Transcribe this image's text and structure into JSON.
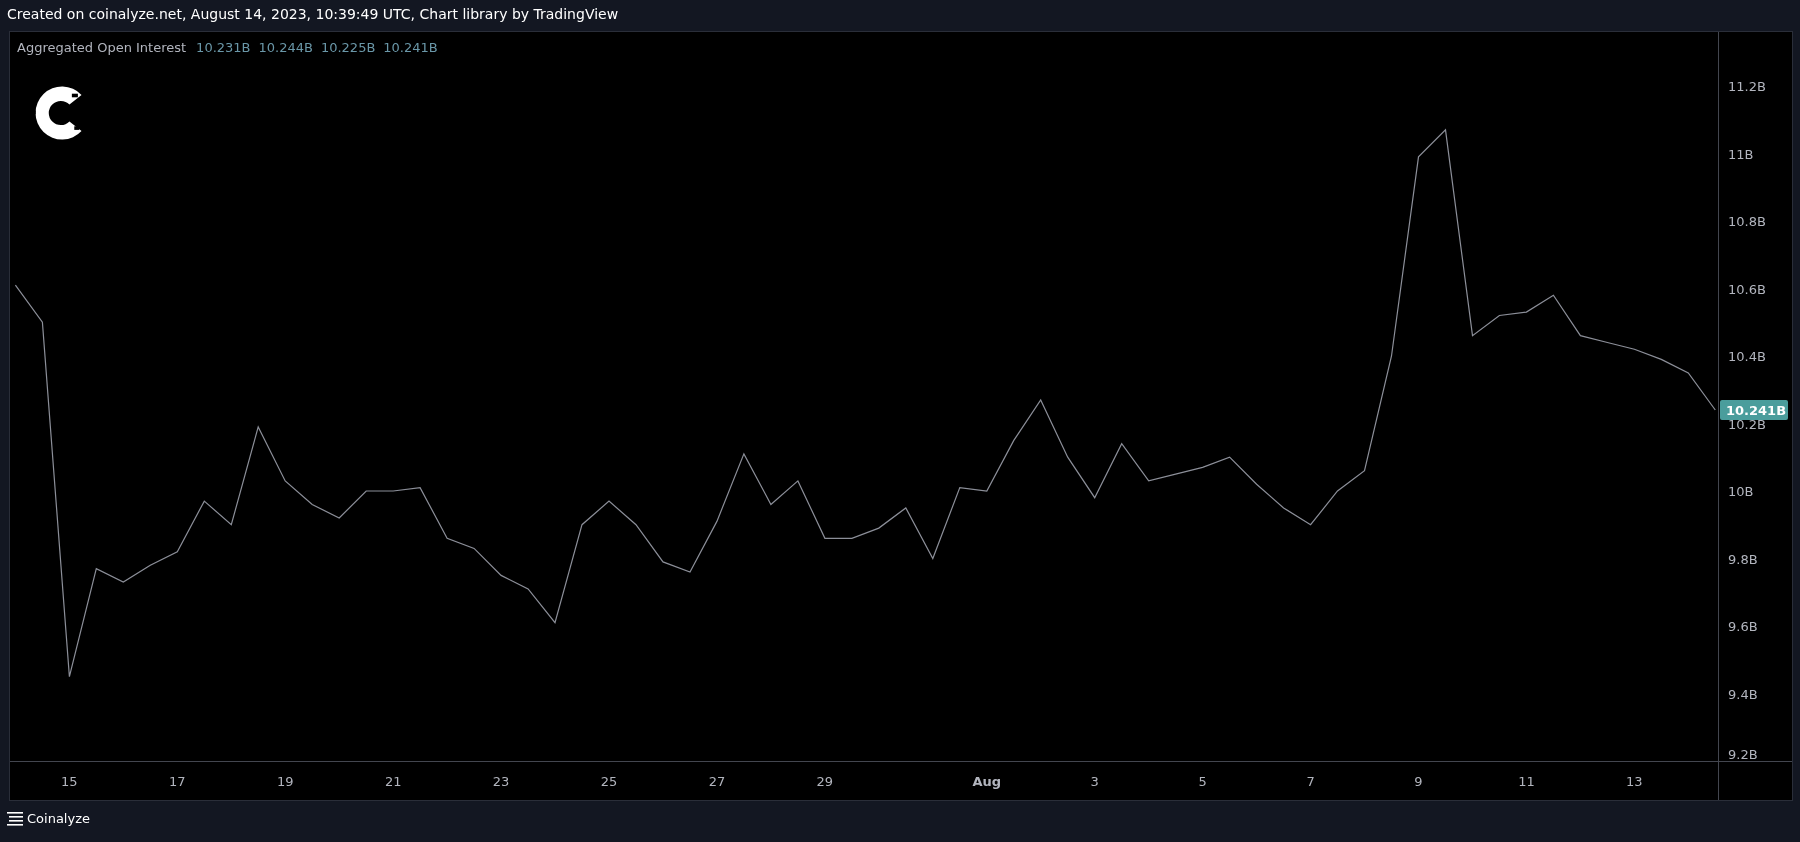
{
  "header": {
    "caption": "Created on coinalyze.net, August 14, 2023, 10:39:49 UTC, Chart library by TradingView"
  },
  "legend": {
    "values": [
      "10.231B",
      "10.244B",
      "10.225B",
      "10.241B"
    ]
  },
  "chart": {
    "last_price": "10.241B",
    "chart_data": {
      "type": "line",
      "title": "Aggregated Open Interest",
      "ylim": [
        9.2,
        11.36
      ],
      "categories": [
        null,
        null,
        "15",
        null,
        null,
        null,
        "17",
        null,
        null,
        null,
        "19",
        null,
        null,
        null,
        "21",
        null,
        null,
        null,
        "23",
        null,
        null,
        null,
        "25",
        null,
        null,
        null,
        "27",
        null,
        null,
        null,
        "29",
        null,
        null,
        null,
        null,
        null,
        "Aug",
        null,
        null,
        null,
        "3",
        null,
        null,
        null,
        "5",
        null,
        null,
        null,
        "7",
        null,
        null,
        null,
        "9",
        null,
        null,
        null,
        "11",
        null,
        null,
        null,
        "13",
        null,
        null,
        null
      ],
      "yticks": [
        {
          "value": 9.2,
          "label": "9.2B"
        },
        {
          "value": 9.4,
          "label": "9.4B"
        },
        {
          "value": 9.6,
          "label": "9.6B"
        },
        {
          "value": 9.8,
          "label": "9.8B"
        },
        {
          "value": 10,
          "label": "10B"
        },
        {
          "value": 10.2,
          "label": "10.2B"
        },
        {
          "value": 10.4,
          "label": "10.4B"
        },
        {
          "value": 10.6,
          "label": "10.6B"
        },
        {
          "value": 10.8,
          "label": "10.8B"
        },
        {
          "value": 11,
          "label": "11B"
        },
        {
          "value": 11.2,
          "label": "11.2B"
        }
      ],
      "series": [
        {
          "color": "#8c8f99",
          "values": [
            10.61,
            10.5,
            9.45,
            9.77,
            9.73,
            9.78,
            9.82,
            9.97,
            9.9,
            10.19,
            10.03,
            9.96,
            9.92,
            10.0,
            10.0,
            10.01,
            9.86,
            9.83,
            9.75,
            9.71,
            9.61,
            9.9,
            9.97,
            9.9,
            9.79,
            9.76,
            9.91,
            10.11,
            9.96,
            10.03,
            9.86,
            9.86,
            9.89,
            9.95,
            9.8,
            10.01,
            10.0,
            10.15,
            10.27,
            10.1,
            9.98,
            10.14,
            10.03,
            10.05,
            10.07,
            10.1,
            10.02,
            9.95,
            9.9,
            10.0,
            10.06,
            10.4,
            10.99,
            11.07,
            10.46,
            10.52,
            10.53,
            10.58,
            10.46,
            10.44,
            10.42,
            10.39,
            10.35,
            10.24
          ]
        }
      ]
    }
  },
  "footer": {
    "brand": "Coinalyze"
  }
}
